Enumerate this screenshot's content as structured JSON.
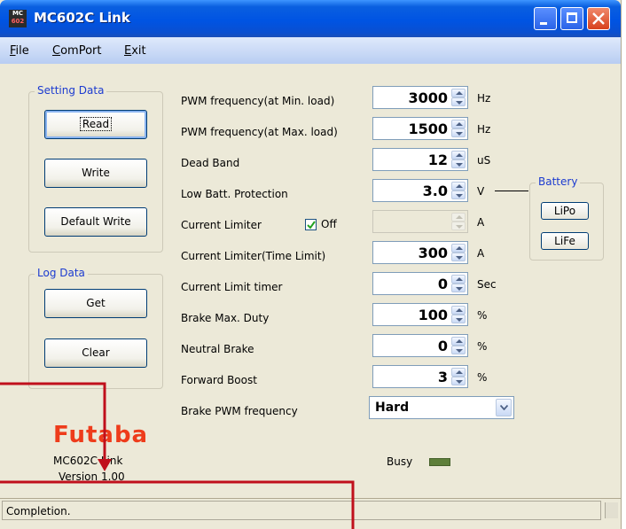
{
  "window": {
    "title": "MC602C  Link",
    "icon_line1": "MC",
    "icon_line2": "602"
  },
  "menu": [
    {
      "label": "File",
      "mnemonic": "F",
      "rest": "ile"
    },
    {
      "label": "ComPort",
      "mnemonic": "C",
      "rest": "omPort"
    },
    {
      "label": "Exit",
      "mnemonic": "E",
      "rest": "xit"
    }
  ],
  "setting_data": {
    "title": "Setting Data",
    "read": "Read",
    "write": "Write",
    "default_write": "Default Write"
  },
  "log_data": {
    "title": "Log Data",
    "get": "Get",
    "clear": "Clear"
  },
  "params": [
    {
      "label": "PWM frequency(at Min. load)",
      "value": "3000",
      "unit": "Hz"
    },
    {
      "label": "PWM frequency(at Max. load)",
      "value": "1500",
      "unit": "Hz"
    },
    {
      "label": "Dead Band",
      "value": "12",
      "unit": "uS"
    },
    {
      "label": "Low Batt. Protection",
      "value": "3.0",
      "unit": "V"
    },
    {
      "label": "Current Limiter",
      "value": "",
      "unit": "A",
      "checkbox_label": "Off",
      "checked": true
    },
    {
      "label": "Current Limiter(Time Limit)",
      "value": "300",
      "unit": "A"
    },
    {
      "label": "Current Limit timer",
      "value": "0",
      "unit": "Sec"
    },
    {
      "label": "Brake Max. Duty",
      "value": "100",
      "unit": "%"
    },
    {
      "label": "Neutral Brake",
      "value": "0",
      "unit": "%"
    },
    {
      "label": "Forward Boost",
      "value": "3",
      "unit": "%"
    },
    {
      "label": "Brake PWM frequency",
      "value": "Hard",
      "unit": ""
    }
  ],
  "battery": {
    "title": "Battery",
    "lipo": "LiPo",
    "life": "LiFe"
  },
  "footer": {
    "logo": "Futaba",
    "app_name": "MC602C Link",
    "version": "Version 1.00",
    "busy_label": "Busy"
  },
  "status": {
    "text": "Completion."
  },
  "colors": {
    "titlebar": "#0054e3",
    "annotation_red": "#c0101c",
    "logo": "#ee3c1b",
    "busy_led": "#5e7f3a"
  }
}
